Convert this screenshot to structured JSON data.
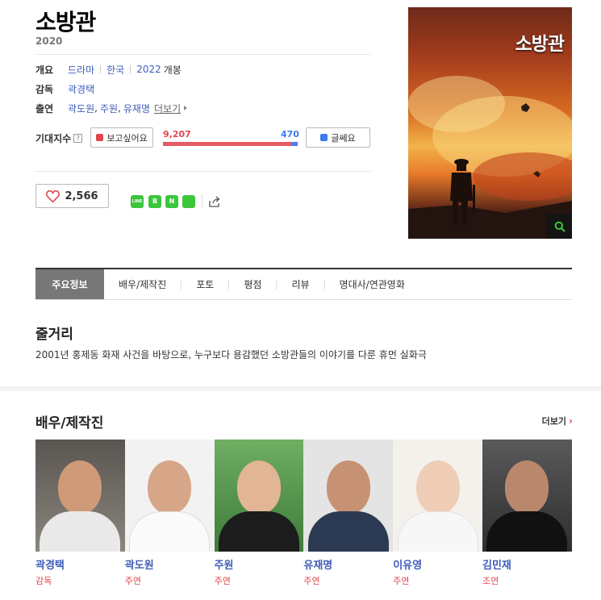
{
  "movie": {
    "title": "소방관",
    "year": "2020"
  },
  "overview": {
    "label": "개요",
    "genre": "드라마",
    "country": "한국",
    "release_year": "2022",
    "release_text": "개봉"
  },
  "director": {
    "label": "감독",
    "name": "곽경택"
  },
  "cast_summary": {
    "label": "출연",
    "names": [
      "곽도원",
      "주원",
      "유재명"
    ],
    "more_label": "더보기"
  },
  "expectation": {
    "label": "기대지수",
    "help": "?",
    "want_label": "보고싶어요",
    "want_count": "9,207",
    "pass_label": "글쎄요",
    "pass_count": "470",
    "want_ratio": 0.951
  },
  "likes": {
    "count": "2,566"
  },
  "social": [
    {
      "name": "line",
      "label": "LINE"
    },
    {
      "name": "band",
      "label": "B"
    },
    {
      "name": "naver-book",
      "label": "N"
    },
    {
      "name": "memo",
      "label": ""
    }
  ],
  "poster": {
    "title": "소방관"
  },
  "tabs": [
    "주요정보",
    "배우/제작진",
    "포토",
    "평점",
    "리뷰",
    "명대사/연관영화"
  ],
  "synopsis": {
    "title": "줄거리",
    "text": "2001년 홍제동 화재 사건을 바탕으로, 누구보다 용감했던 소방관들의 이야기를 다룬 휴먼 실화극"
  },
  "cast_section": {
    "title": "배우/제작진",
    "more_label": "더보기",
    "people": [
      {
        "name": "곽경택",
        "role": "감독"
      },
      {
        "name": "곽도원",
        "role": "주연"
      },
      {
        "name": "주원",
        "role": "주연"
      },
      {
        "name": "유재명",
        "role": "주연"
      },
      {
        "name": "이유영",
        "role": "주연"
      },
      {
        "name": "김민재",
        "role": "조연"
      }
    ]
  },
  "colors": {
    "link": "#3e5cb8",
    "accent_red": "#e0474c",
    "accent_blue": "#3e79e8",
    "green": "#3cc63c"
  }
}
